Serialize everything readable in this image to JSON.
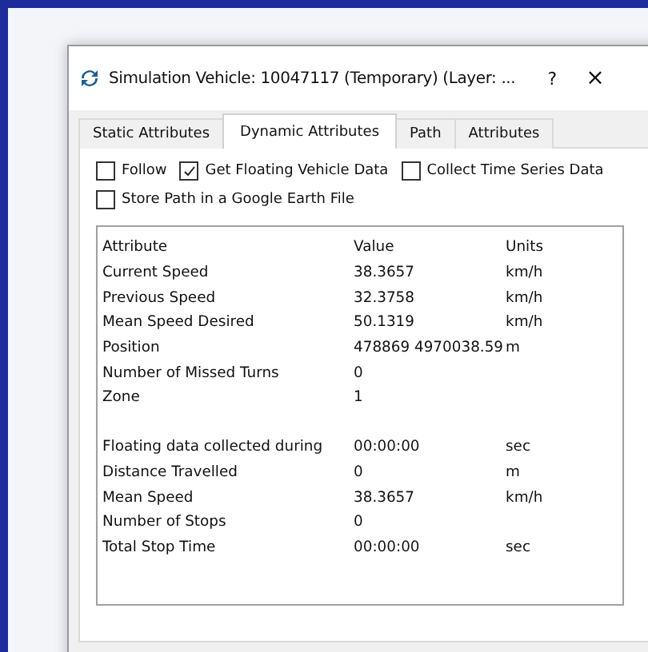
{
  "window": {
    "title": "Simulation Vehicle: 10047117 (Temporary) (Layer: ...",
    "help": "?",
    "close": "×"
  },
  "tabs": [
    {
      "label": "Static Attributes",
      "selected": false
    },
    {
      "label": "Dynamic Attributes",
      "selected": true
    },
    {
      "label": "Path",
      "selected": false
    },
    {
      "label": "Attributes",
      "selected": false
    }
  ],
  "options": [
    {
      "label": "Follow",
      "checked": false
    },
    {
      "label": "Get Floating Vehicle Data",
      "checked": true
    },
    {
      "label": "Collect Time Series Data",
      "checked": false
    },
    {
      "label": "Store Path in a Google Earth File",
      "checked": false
    }
  ],
  "table": {
    "columns": [
      "Attribute",
      "Value",
      "Units"
    ],
    "groups": [
      [
        {
          "attribute": "Current Speed",
          "value": "38.3657",
          "units": "km/h"
        },
        {
          "attribute": "Previous Speed",
          "value": "32.3758",
          "units": "km/h"
        },
        {
          "attribute": "Mean Speed Desired",
          "value": "50.1319",
          "units": "km/h"
        },
        {
          "attribute": "Position",
          "value": "478869 4970038.59",
          "units": "m"
        },
        {
          "attribute": "Number of Missed Turns",
          "value": "0"
        },
        {
          "attribute": "Zone",
          "value": "1"
        }
      ],
      [
        {
          "attribute": "Floating data collected during",
          "value": "00:00:00",
          "units": "sec"
        },
        {
          "attribute": "Distance Travelled",
          "value": "0",
          "units": "m"
        },
        {
          "attribute": "Mean Speed",
          "value": "38.3657",
          "units": "km/h"
        },
        {
          "attribute": "Number of Stops",
          "value": "0"
        },
        {
          "attribute": "Total Stop Time",
          "value": "00:00:00",
          "units": "sec"
        }
      ]
    ]
  }
}
